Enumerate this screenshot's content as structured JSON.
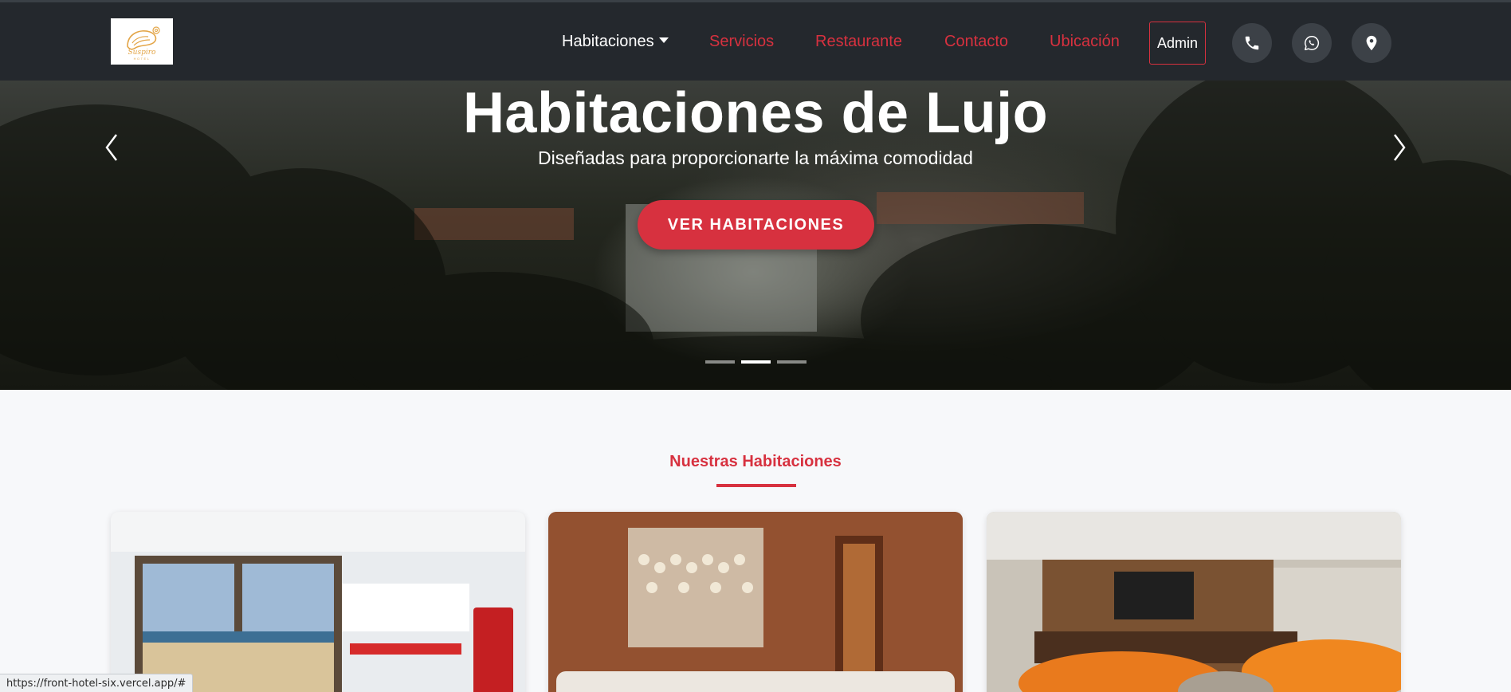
{
  "navbar": {
    "logo_name": "Suspiro",
    "logo_sub": "HOTEL",
    "items": [
      {
        "label": "Habitaciones",
        "has_dropdown": true
      },
      {
        "label": "Servicios"
      },
      {
        "label": "Restaurante"
      },
      {
        "label": "Contacto"
      },
      {
        "label": "Ubicación"
      }
    ],
    "admin_label": "Admin",
    "icons": [
      "phone-icon",
      "whatsapp-icon",
      "location-pin-icon"
    ]
  },
  "hero": {
    "title": "Habitaciones de Lujo",
    "subtitle": "Diseñadas para proporcionarte la máxima comodidad",
    "cta_label": "VER HABITACIONES",
    "slide_count": 3,
    "active_slide": 2
  },
  "rooms_section": {
    "title": "Nuestras Habitaciones",
    "cards": [
      {
        "photo": "kitchen-beach-view-photo"
      },
      {
        "photo": "macrame-living-room-photo"
      },
      {
        "photo": "orange-sofa-lounge-photo"
      }
    ]
  },
  "status_bar": {
    "url": "https://front-hotel-six.vercel.app/#"
  },
  "colors": {
    "accent": "#d7313f",
    "navbar_bg": "#24282d",
    "page_bg": "#f7f8fa"
  }
}
